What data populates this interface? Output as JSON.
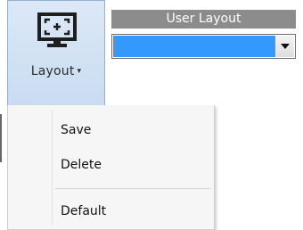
{
  "layout_button": {
    "label": "Layout",
    "caret": "▾",
    "icon": "monitor-focus-icon"
  },
  "user_layout": {
    "header": "User Layout",
    "selected_value": ""
  },
  "menu": {
    "items": [
      {
        "label": "Save"
      },
      {
        "label": "Delete"
      },
      {
        "label": "Default"
      }
    ]
  },
  "colors": {
    "button_bg": "#d3e2f4",
    "button_border": "#8fb0d6",
    "header_bg": "#8c8c8c",
    "selection": "#3399ff"
  }
}
